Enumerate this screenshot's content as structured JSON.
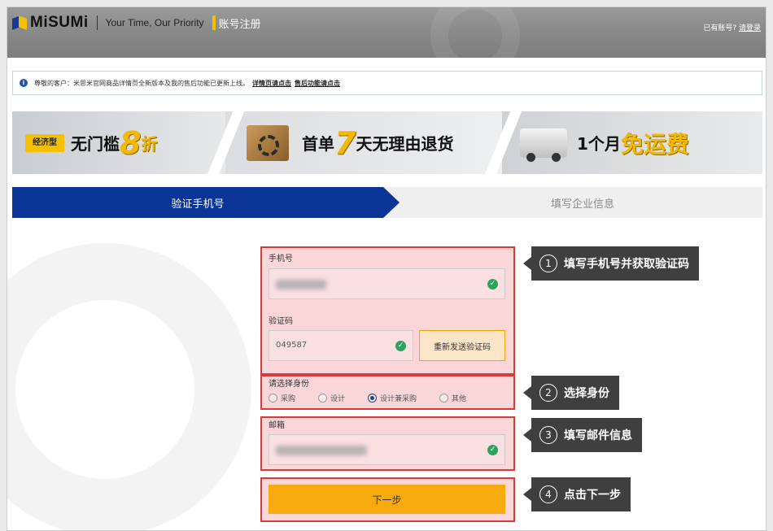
{
  "header": {
    "brand": "MiSUMi",
    "slogan": "Your Time, Our Priority",
    "page_title": "账号注册",
    "login_prompt": "已有账号?",
    "login_link": "请登录"
  },
  "notice": {
    "text": "尊敬的客户：米思米官网商品详情页全新版本及我的售后功能已更新上线。",
    "link1": "详情页请点击",
    "link2": "售后功能请点击"
  },
  "banner": {
    "badge": "经济型",
    "seg1_text": "无门槛",
    "seg1_big": "8",
    "seg1_suffix": "折",
    "seg2_prefix": "首单",
    "seg2_big": "7",
    "seg2_suffix": "天无理由退货",
    "seg3_prefix": "1个月",
    "seg3_highlight": "免运费"
  },
  "steps": {
    "active": "验证手机号",
    "next": "填写企业信息"
  },
  "form": {
    "phone_label": "手机号",
    "code_label": "验证码",
    "code_value": "049587",
    "resend_label": "重新发送验证码",
    "role_label": "请选择身份",
    "roles": [
      "采购",
      "设计",
      "设计兼采购",
      "其他"
    ],
    "selected_role": "设计兼采购",
    "email_label": "邮箱",
    "next_label": "下一步"
  },
  "callouts": [
    {
      "num": "1",
      "text": "填写手机号并获取验证码"
    },
    {
      "num": "2",
      "text": "选择身份"
    },
    {
      "num": "3",
      "text": "填写邮件信息"
    },
    {
      "num": "4",
      "text": "点击下一步"
    }
  ],
  "colors": {
    "brand_blue": "#0a3596",
    "accent_yellow": "#f7aa0e",
    "highlight_red": "#d93a3a",
    "check_green": "#2aa35c"
  }
}
